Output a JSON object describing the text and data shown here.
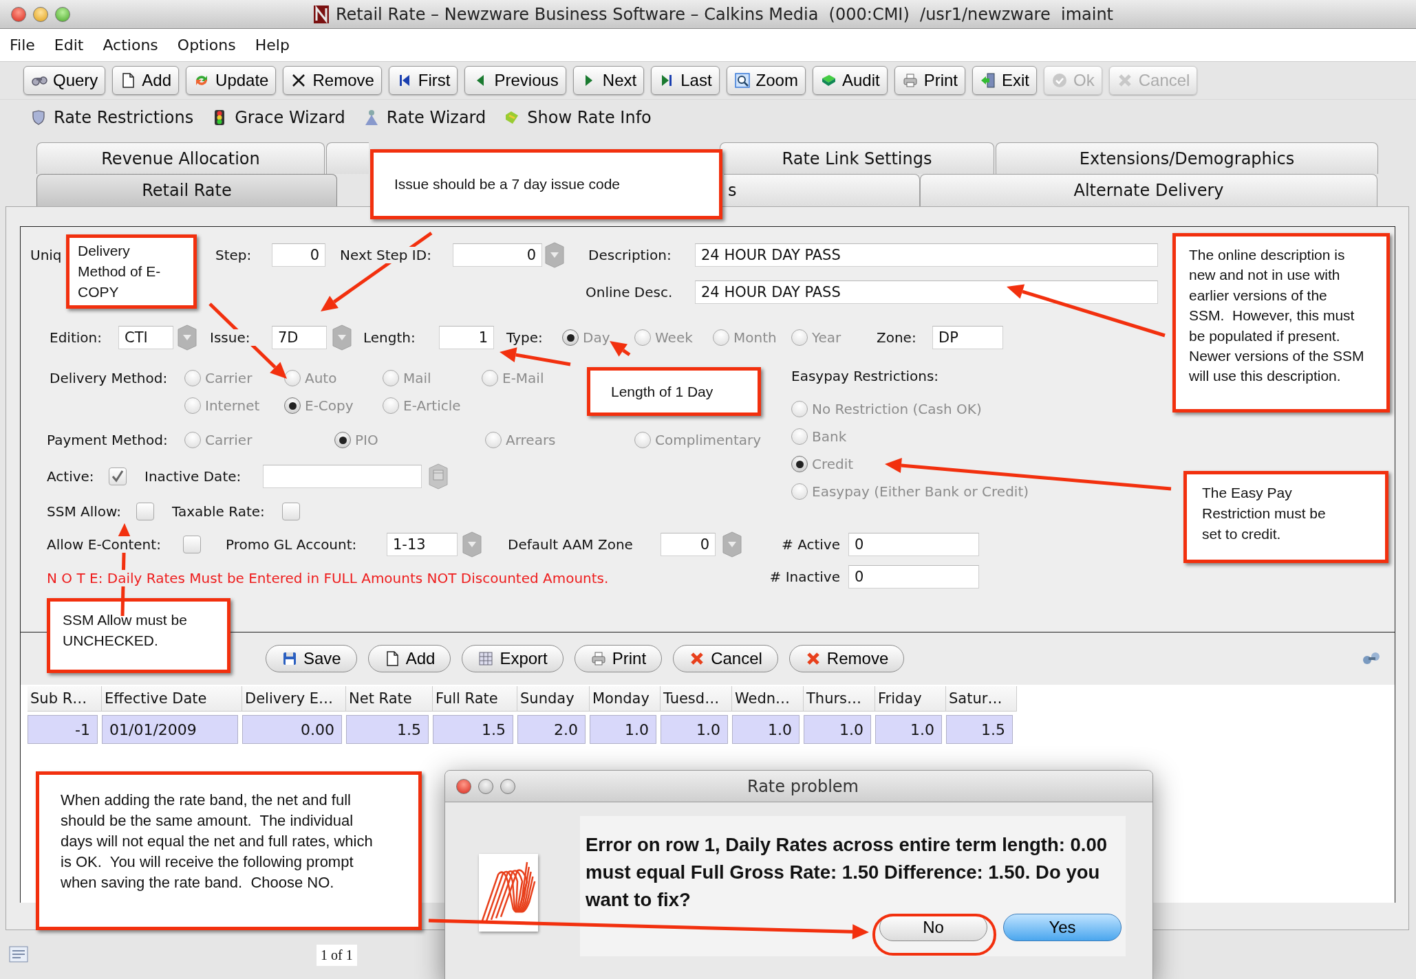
{
  "window": {
    "title": "Retail Rate – Newzware Business Software – Calkins Media  (000:CMI)  /usr1/newzware  imaint"
  },
  "menu": [
    "File",
    "Edit",
    "Actions",
    "Options",
    "Help"
  ],
  "toolbar": [
    {
      "label": "Query",
      "disabled": false
    },
    {
      "label": "Add",
      "disabled": false
    },
    {
      "label": "Update",
      "disabled": false
    },
    {
      "label": "Remove",
      "disabled": false
    },
    {
      "label": "First",
      "disabled": false
    },
    {
      "label": "Previous",
      "disabled": false
    },
    {
      "label": "Next",
      "disabled": false
    },
    {
      "label": "Last",
      "disabled": false
    },
    {
      "label": "Zoom",
      "disabled": false
    },
    {
      "label": "Audit",
      "disabled": false
    },
    {
      "label": "Print",
      "disabled": false
    },
    {
      "label": "Exit",
      "disabled": false
    },
    {
      "label": "Ok",
      "disabled": true
    },
    {
      "label": "Cancel",
      "disabled": true
    }
  ],
  "tools": [
    "Rate Restrictions",
    "Grace Wizard",
    "Rate Wizard",
    "Show Rate Info"
  ],
  "tabs": {
    "row_1": [
      {
        "label": "Revenue Allocation",
        "selected": false
      },
      {
        "selected": false
      },
      {
        "label": "Rate Link Settings",
        "selected": false
      },
      {
        "label": "Extensions/Demographics",
        "selected": false
      }
    ],
    "row_2": [
      {
        "label": "Retail Rate",
        "selected": true
      },
      {
        "label": "s",
        "selected": false
      },
      {
        "label": "Alternate Delivery",
        "selected": false
      }
    ]
  },
  "form": {
    "unique_label": "Uniq",
    "step": {
      "label": "Step:",
      "value": "0"
    },
    "next_step_id": {
      "label": "Next Step ID:",
      "value": "0"
    },
    "description": {
      "label": "Description:",
      "value": "24 HOUR DAY PASS"
    },
    "online_desc": {
      "label": "Online Desc.",
      "value": "24 HOUR DAY PASS"
    },
    "edition": {
      "label": "Edition:",
      "value": "CTI"
    },
    "issue": {
      "label": "Issue:",
      "value": "7D"
    },
    "length": {
      "label": "Length:",
      "value": "1"
    },
    "type": {
      "label": "Type:",
      "options": [
        {
          "label": "Day",
          "selected": true
        },
        {
          "label": "Week",
          "selected": false
        },
        {
          "label": "Month",
          "selected": false
        },
        {
          "label": "Year",
          "selected": false
        }
      ]
    },
    "zone": {
      "label": "Zone:",
      "value": "DP"
    },
    "delivery_method": {
      "label": "Delivery Method:",
      "options": [
        {
          "label": "Carrier",
          "selected": false
        },
        {
          "label": "Auto",
          "selected": false
        },
        {
          "label": "Mail",
          "selected": false
        },
        {
          "label": "E-Mail",
          "selected": false
        },
        {
          "label": "Internet",
          "selected": false
        },
        {
          "label": "E-Copy",
          "selected": true
        },
        {
          "label": "E-Article",
          "selected": false
        }
      ]
    },
    "payment_method": {
      "label": "Payment Method:",
      "options": [
        {
          "label": "Carrier",
          "selected": false
        },
        {
          "label": "PIO",
          "selected": true
        },
        {
          "label": "Arrears",
          "selected": false
        },
        {
          "label": "Complimentary",
          "selected": false
        }
      ]
    },
    "active": {
      "label": "Active:",
      "checked": true
    },
    "inactive_date": {
      "label": "Inactive Date:"
    },
    "ssm_allow": {
      "label": "SSM Allow:",
      "checked": false
    },
    "taxable_rate": {
      "label": "Taxable Rate:",
      "checked": false
    },
    "allow_e_content": {
      "label": "Allow E-Content:",
      "checked": false
    },
    "promo_gl_account": {
      "label": "Promo GL Account:",
      "value": "1-13"
    },
    "default_aam_zone": {
      "label": "Default AAM Zone",
      "value": "0"
    },
    "easypay_restrictions": {
      "label": "Easypay Restrictions:",
      "options": [
        {
          "label": "No Restriction (Cash OK)",
          "selected": false
        },
        {
          "label": "Bank",
          "selected": false
        },
        {
          "label": "Credit",
          "selected": true
        },
        {
          "label": "Easypay (Either Bank or Credit)",
          "selected": false
        }
      ]
    },
    "active_count": {
      "label": "# Active",
      "value": "0"
    },
    "inactive_count": {
      "label": "# Inactive",
      "value": "0"
    },
    "note": "N O T E: Daily Rates Must be Entered in FULL Amounts NOT Discounted Amounts."
  },
  "grid_buttons": [
    "Save",
    "Add",
    "Export",
    "Print",
    "Cancel",
    "Remove"
  ],
  "table": {
    "columns": [
      "Sub R…",
      "Effective Date",
      "Delivery E…",
      "Net Rate",
      "Full Rate",
      "Sunday",
      "Monday",
      "Tuesd…",
      "Wedn…",
      "Thurs…",
      "Friday",
      "Satur…"
    ],
    "rows": [
      [
        "-1",
        "01/01/2009",
        "0.00",
        "1.5",
        "1.5",
        "2.0",
        "1.0",
        "1.0",
        "1.0",
        "1.0",
        "1.0",
        "1.5"
      ]
    ]
  },
  "status_bar": {
    "pager": "1 of 1"
  },
  "dialog": {
    "title": "Rate problem",
    "message": "Error on row 1, Daily Rates across entire term length: 0.00 must equal Full Gross Rate: 1.50 Difference: 1.50. Do you want to fix?",
    "buttons": [
      {
        "label": "No",
        "default": false
      },
      {
        "label": "Yes",
        "default": true
      }
    ]
  },
  "callouts": [
    "Issue should be a 7 day issue code",
    "Delivery Method of E-COPY",
    "Length of 1 Day",
    "The online description is new and not in use with earlier versions of the SSM.  However, this must be populated if present.  Newer versions of the SSM will use this description.",
    "The Easy Pay Restriction must be set to credit.",
    "SSM Allow must be UNCHECKED.",
    "When adding the rate band, the net and full should be the same amount.  The individual days will not equal the net and full rates, which is OK.  You will receive the following prompt when saving the rate band.  Choose NO."
  ]
}
